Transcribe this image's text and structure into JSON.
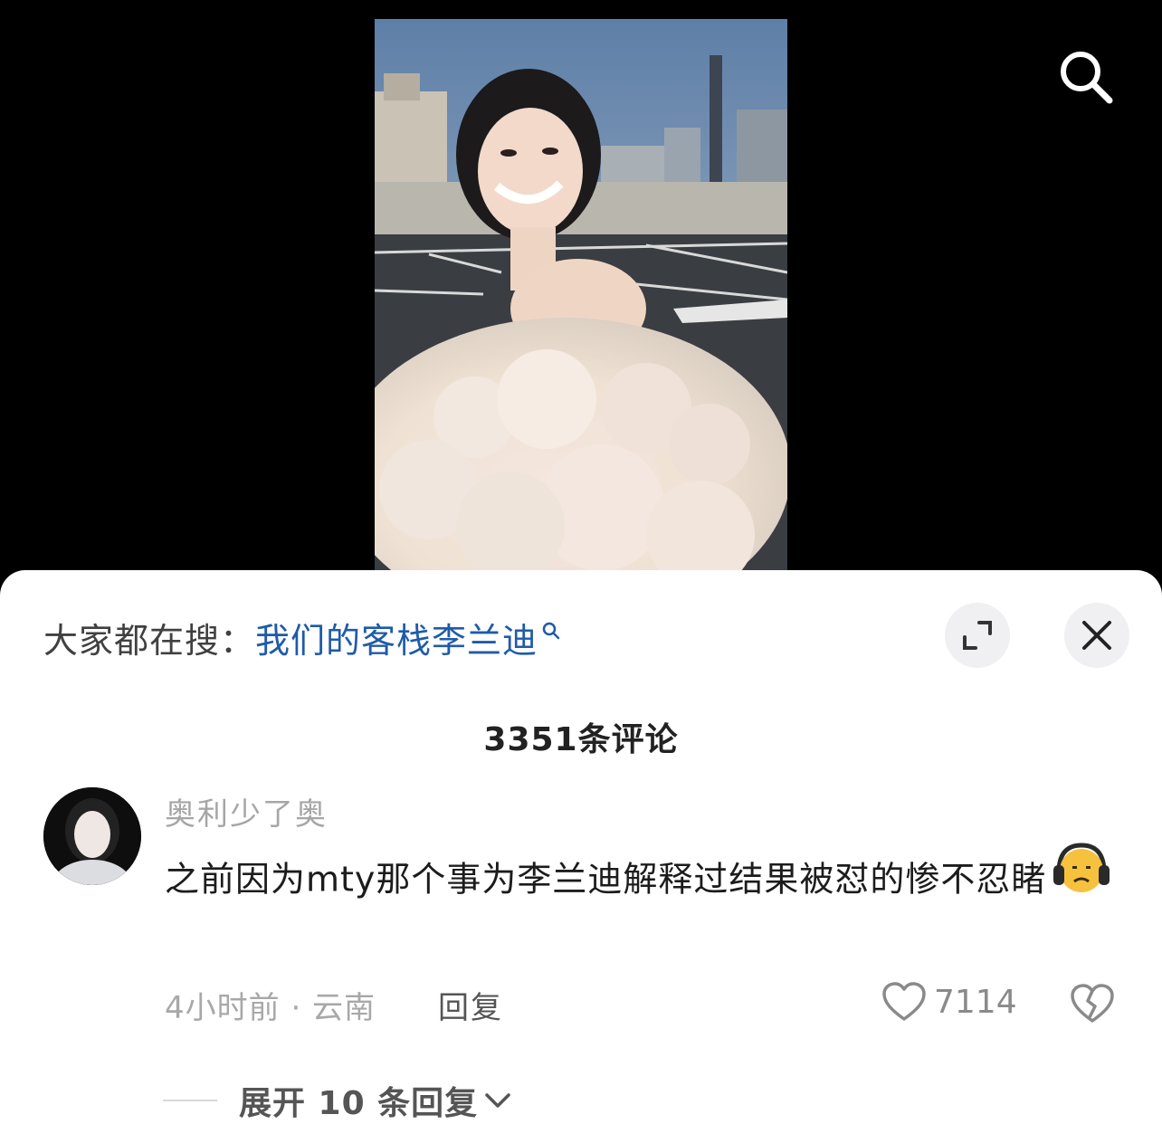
{
  "header": {
    "search_icon": "search-icon"
  },
  "hot_search": {
    "prefix": "大家都在搜：",
    "query": "我们的客栈李兰迪"
  },
  "sheet_controls": {
    "expand_icon": "expand-icon",
    "close_icon": "close-icon"
  },
  "comments": {
    "count_label": "3351条评论",
    "items": [
      {
        "username": "奥利少了奥",
        "text": "之前因为mty那个事为李兰迪解释过结果被怼的惨不忍睹",
        "emoji": "headphones-sad-face-emoji",
        "time_location": "4小时前 · 云南",
        "reply_label": "回复",
        "like_count": "7114",
        "expand_replies_label": "展开 10 条回复"
      }
    ]
  },
  "colors": {
    "link": "#1f5ba8",
    "sheet_background": "#ffffff",
    "page_background": "#000000"
  }
}
